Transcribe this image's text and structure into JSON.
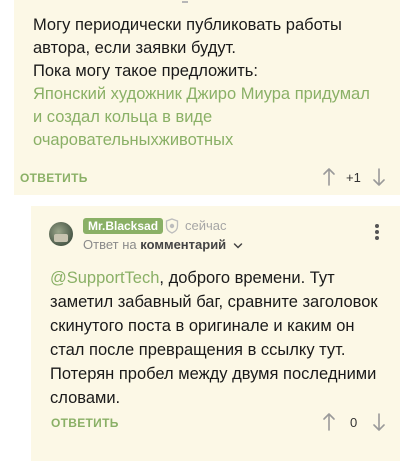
{
  "comment1": {
    "paragraph1": "Могу периодически публиковать работы автора, если заявки будут.",
    "paragraph2": "Пока могу такое предложить:",
    "link_text": "Японский художник Джиро Миура придумал и создал кольца в виде очаровательныхживотных",
    "reply_label": "ОТВЕТИТЬ",
    "score": "+1"
  },
  "comment2": {
    "author": "Mr.Blacksad",
    "time": "сейчас",
    "reply_prefix": "Ответ на",
    "reply_target": "комментарий",
    "mention": "@SupportTech",
    "text": ", доброго времени. Тут заметил забавный баг, сравните заголовок скинутого поста в оригинале и каким он стал после превращения в ссылку тут. Потерян пробел между двумя последними словами.",
    "reply_label": "ОТВЕТИТЬ",
    "score": "0"
  },
  "colors": {
    "accent": "#8ab066",
    "card_bg": "#fcf8e6"
  },
  "icons": [
    "arrow-up-icon",
    "arrow-down-icon",
    "shield-icon",
    "chevron-down-icon",
    "more-vertical-icon",
    "avatar"
  ]
}
